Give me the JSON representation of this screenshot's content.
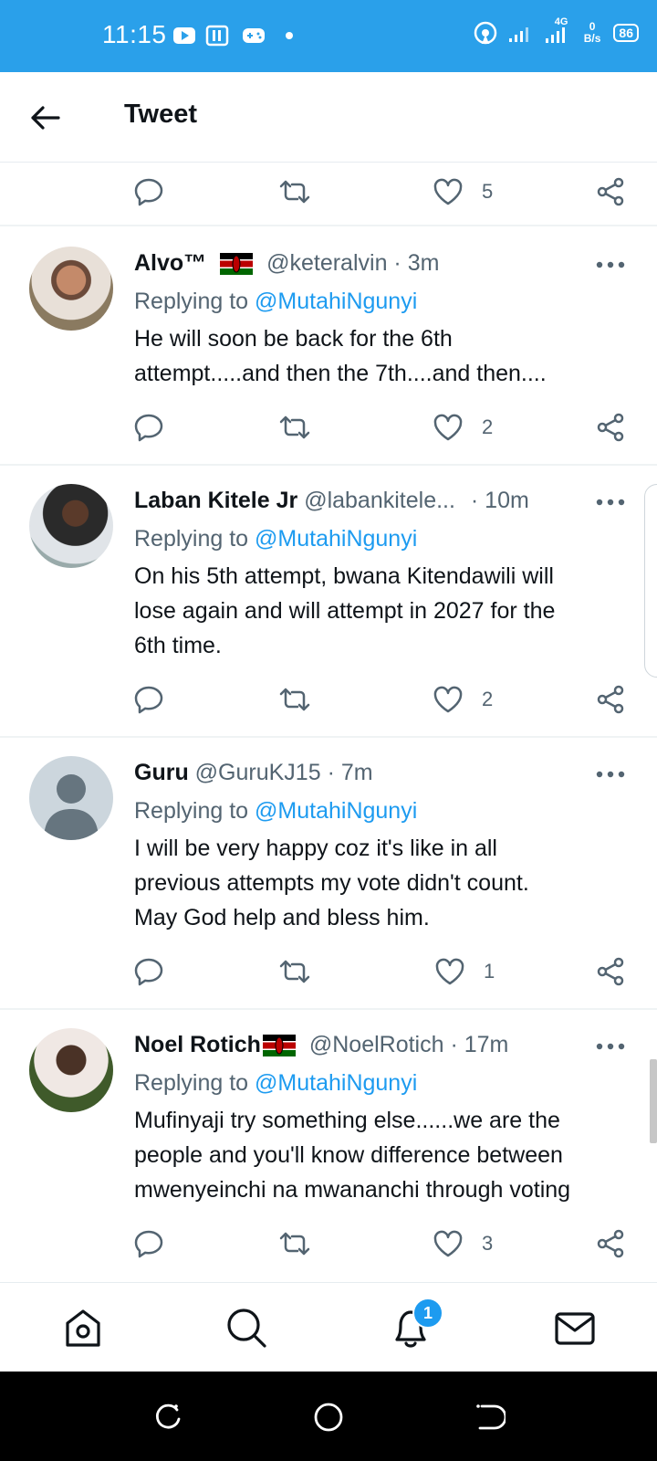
{
  "status_bar": {
    "time": "11:15",
    "network": "4G",
    "speed_value": "0",
    "speed_unit": "B/s",
    "battery": "86"
  },
  "header": {
    "title": "Tweet"
  },
  "top_actions": {
    "likes": "5"
  },
  "tweets": [
    {
      "name": "Alvo™",
      "handle": "@keteralvin",
      "time": "· 3m",
      "replying_label": "Replying to",
      "replying_to": "@MutahiNgunyi",
      "text_lines": [
        "He will soon be back for the 6th",
        "attempt.....and then the 7th....and then...."
      ],
      "likes": "2"
    },
    {
      "name": "Laban Kitele Jr",
      "handle": "@labankitele...",
      "time": "· 10m",
      "replying_label": "Replying to",
      "replying_to": "@MutahiNgunyi",
      "text_lines": [
        "On his 5th attempt, bwana Kitendawili will",
        "lose again and will attempt in 2027 for the",
        "6th time."
      ],
      "likes": "2"
    },
    {
      "name": "Guru",
      "handle": "@GuruKJ15",
      "time": "· 7m",
      "replying_label": "Replying to",
      "replying_to": "@MutahiNgunyi",
      "text_lines": [
        "I will be very happy coz it's like in all",
        "previous attempts my vote didn't count.",
        "May God help and bless him."
      ],
      "likes": "1"
    },
    {
      "name": "Noel Rotich",
      "handle": "@NoelRotich",
      "time": "· 17m",
      "replying_label": "Replying to",
      "replying_to": "@MutahiNgunyi",
      "text_lines": [
        "Mufinyaji try something else......we are the",
        "people and you'll know difference between",
        "mwenyeinchi na mwananchi through voting"
      ],
      "likes": "3"
    }
  ],
  "bottom_nav": {
    "notification_count": "1"
  },
  "colors": {
    "status_bar": "#2aa0ea",
    "accent": "#1d9bf0",
    "text": "#0f1419",
    "secondary_text": "#536471"
  },
  "icons": {
    "reply": "reply-icon",
    "retweet": "retweet-icon",
    "like": "heart-icon",
    "share": "share-icon",
    "more": "more-icon"
  }
}
